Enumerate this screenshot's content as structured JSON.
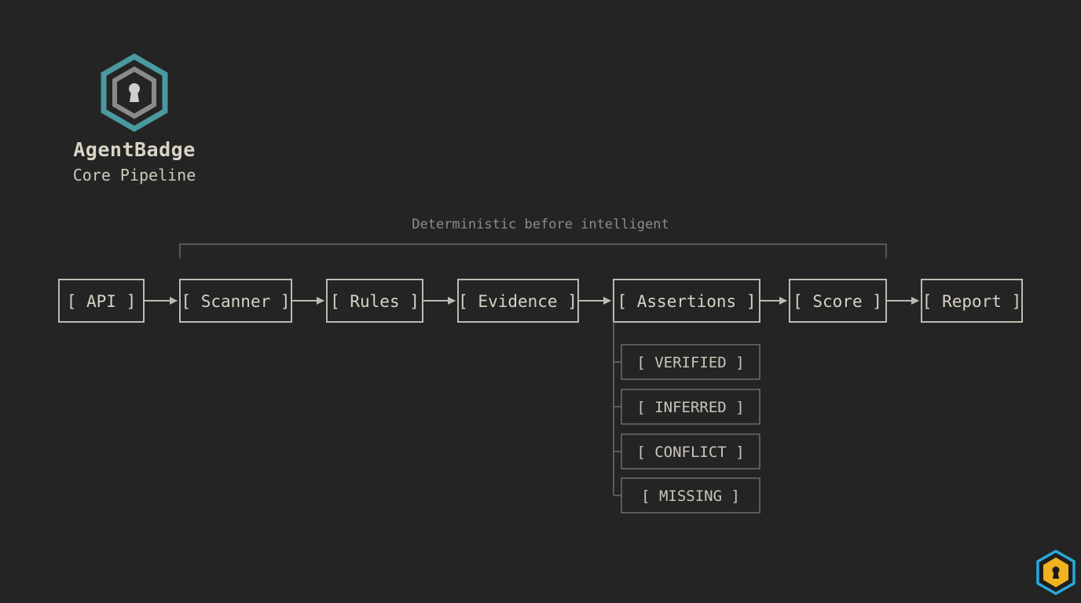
{
  "brand": {
    "name": "AgentBadge",
    "subtitle": "Core Pipeline",
    "logo_icon": "keyhole-hexagon-icon",
    "logo_colors": {
      "outer": "#4a9aa0",
      "inner": "#8a8a8a",
      "keyhole": "#2e2e2e"
    }
  },
  "caption": "Deterministic before intelligent",
  "pipeline": [
    {
      "id": "api",
      "label": "[ API ]"
    },
    {
      "id": "scanner",
      "label": "[ Scanner ]"
    },
    {
      "id": "rules",
      "label": "[ Rules ]"
    },
    {
      "id": "evidence",
      "label": "[ Evidence ]"
    },
    {
      "id": "assertions",
      "label": "[ Assertions ]"
    },
    {
      "id": "score",
      "label": "[ Score ]"
    },
    {
      "id": "report",
      "label": "[ Report ]"
    }
  ],
  "assertion_states": [
    {
      "id": "verified",
      "label": "[ VERIFIED ]"
    },
    {
      "id": "inferred",
      "label": "[ INFERRED ]"
    },
    {
      "id": "conflict",
      "label": "[ CONFLICT ]"
    },
    {
      "id": "missing",
      "label": "[ MISSING ]"
    }
  ],
  "corner_badge": {
    "icon": "keyhole-hexagon-icon",
    "colors": {
      "outer": "#29a9d8",
      "inner": "#f0b21e",
      "keyhole": "#1a1a1a"
    }
  },
  "colors": {
    "background": "#242424",
    "node_border": "#bdbab0",
    "state_border": "#6e6d69",
    "bracket_line": "#6a6966",
    "arrow": "#bdbab0"
  }
}
